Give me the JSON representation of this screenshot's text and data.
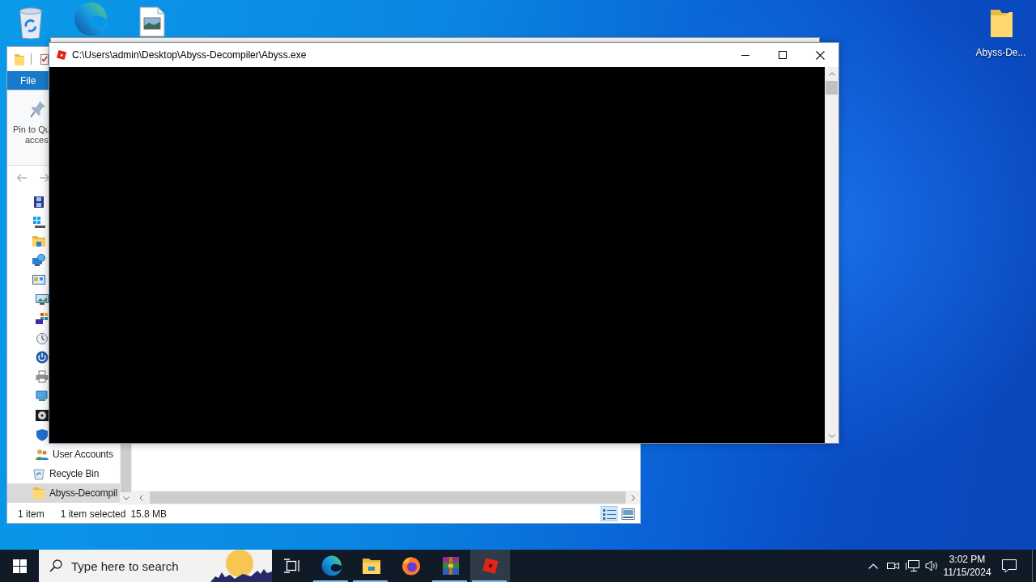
{
  "desktop": {
    "top_row_icons": [
      {
        "kind": "recycle-bin"
      },
      {
        "kind": "browser"
      },
      {
        "kind": "image-file"
      }
    ],
    "right_column_icons": [
      {
        "kind": "folder",
        "label": "Abyss-De..."
      }
    ]
  },
  "explorer": {
    "ribbon_tab": "File",
    "pin_button": [
      "Pin to Qu",
      "acces"
    ],
    "nav_pane": {
      "items": [
        {
          "kind": "film",
          "selected": false
        },
        {
          "kind": "tiles",
          "selected": false
        },
        {
          "kind": "explorer",
          "selected": false
        },
        {
          "kind": "network",
          "selected": false
        },
        {
          "kind": "control-panel",
          "selected": false,
          "children": [
            {
              "kind": "display",
              "selected": false
            },
            {
              "kind": "color-grid",
              "selected": false
            },
            {
              "kind": "clock",
              "selected": false
            },
            {
              "kind": "power",
              "selected": false
            },
            {
              "kind": "printer",
              "selected": false
            },
            {
              "kind": "network-computer",
              "selected": false
            },
            {
              "kind": "disc",
              "selected": false
            },
            {
              "kind": "shield",
              "selected": false
            },
            {
              "kind": "users",
              "label": "User Accounts",
              "selected": false
            }
          ]
        },
        {
          "kind": "recycle-bin",
          "label": "Recycle Bin",
          "selected": false
        },
        {
          "kind": "folder",
          "label": "Abyss-Decompil",
          "selected": true
        }
      ]
    },
    "status_bar": {
      "item_count": "1 item",
      "selection": "1 item selected",
      "size": "15.8 MB",
      "views": [
        {
          "kind": "details",
          "selected": true
        },
        {
          "kind": "large-icons",
          "selected": false
        }
      ]
    }
  },
  "console": {
    "title": "C:\\Users\\admin\\Desktop\\Abyss-Decompiler\\Abyss.exe"
  },
  "taskbar": {
    "search": {
      "placeholder": "Type here to search"
    },
    "apps": [
      {
        "kind": "browser",
        "running": true,
        "selected": false
      },
      {
        "kind": "file-explorer",
        "running": true,
        "selected": false
      },
      {
        "kind": "firefox",
        "running": false,
        "selected": false
      },
      {
        "kind": "archiver",
        "running": true,
        "selected": false
      },
      {
        "kind": "game",
        "running": true,
        "selected": true
      }
    ],
    "clock": {
      "time": "3:02 PM",
      "date": "11/15/2024"
    }
  }
}
